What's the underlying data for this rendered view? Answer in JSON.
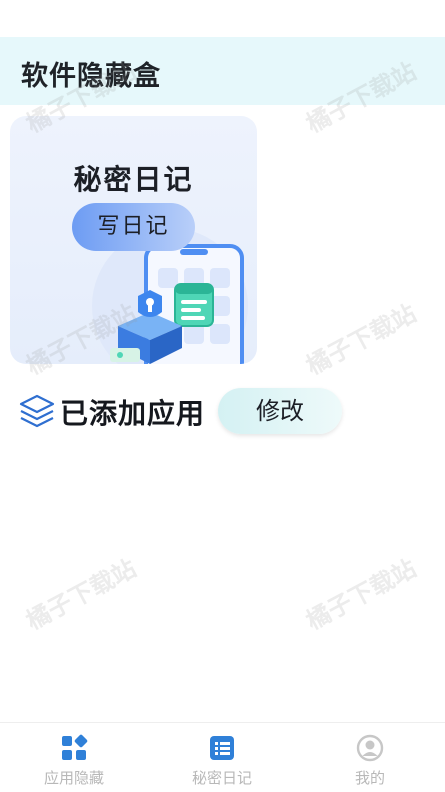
{
  "header": {
    "title": "软件隐藏盒"
  },
  "diary_card": {
    "title": "秘密日记",
    "button_label": "写日记"
  },
  "section": {
    "title": "已添加应用",
    "edit_label": "修改"
  },
  "watermark": {
    "text": "橘子下载站"
  },
  "tabbar": {
    "tabs": [
      {
        "label": "应用隐藏",
        "icon": "grid-icon",
        "active": true
      },
      {
        "label": "秘密日记",
        "icon": "list-icon",
        "active": false
      },
      {
        "label": "我的",
        "icon": "user-icon",
        "active": false
      }
    ]
  },
  "colors": {
    "accent": "#2f80d8",
    "header_bg": "#e6f8fb",
    "tab_inactive": "#b8b8b8",
    "tab_icon_inactive": "#c7c7c7"
  }
}
